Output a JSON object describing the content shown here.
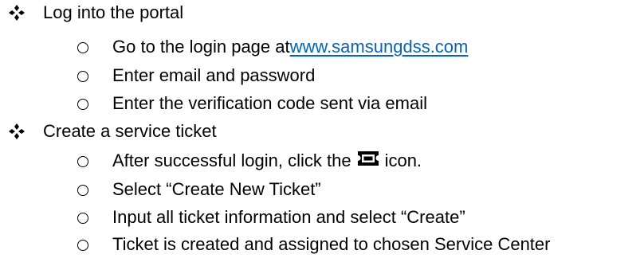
{
  "sections": [
    {
      "title": "Log into the portal",
      "items": [
        {
          "prefix": "Go to the login page at ",
          "link": "www.samsungdss.com",
          "suffix": ""
        },
        {
          "prefix": "Enter email and password"
        },
        {
          "prefix": "Enter the verification code sent via email"
        }
      ]
    },
    {
      "title": "Create a service ticket",
      "items": [
        {
          "prefix": "After successful login, click the",
          "icon": "ticket-icon",
          "suffix": " icon."
        },
        {
          "prefix": "Select “Create New Ticket”"
        },
        {
          "prefix": "Input all ticket information and select “Create”"
        },
        {
          "prefix": "Ticket is created and assigned to chosen Service Center"
        }
      ]
    }
  ],
  "colors": {
    "text": "#000000",
    "link": "#0563C1"
  },
  "icons": {
    "level1_bullet": "four-diamond-bullet-icon",
    "level2_bullet": "hollow-circle-bullet-icon"
  }
}
